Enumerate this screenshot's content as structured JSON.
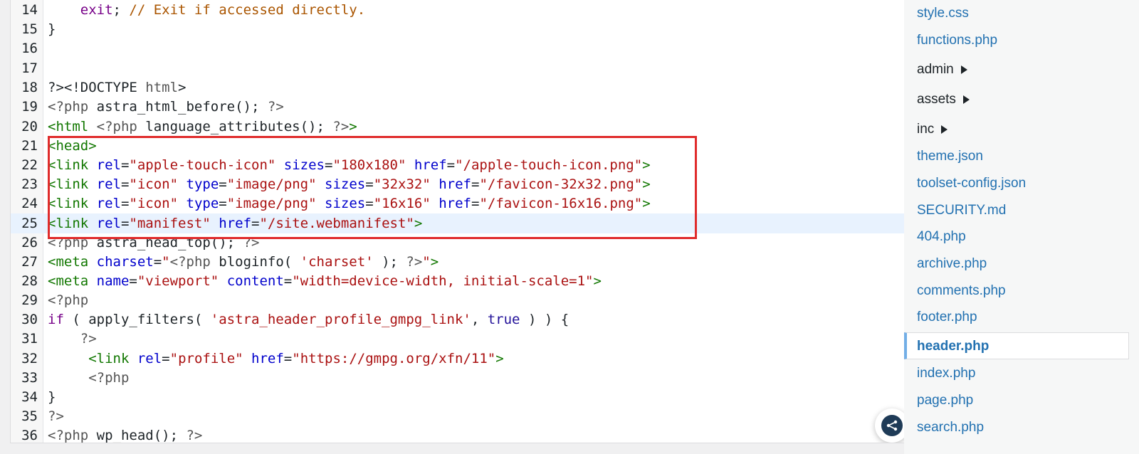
{
  "editor": {
    "lines": [
      {
        "num": "14",
        "indent": "    ",
        "tokens": [
          {
            "t": "exit",
            "c": "kw"
          },
          {
            "t": "; ",
            "c": ""
          },
          {
            "t": "// Exit if accessed directly.",
            "c": "cm"
          }
        ]
      },
      {
        "num": "15",
        "tokens": [
          {
            "t": "}",
            "c": ""
          }
        ]
      },
      {
        "num": "16",
        "tokens": []
      },
      {
        "num": "17",
        "tokens": []
      },
      {
        "num": "18",
        "tokens": [
          {
            "t": "?><!DOCTYPE ",
            "c": ""
          },
          {
            "t": "html",
            "c": "meta"
          },
          {
            "t": ">",
            "c": ""
          }
        ]
      },
      {
        "num": "19",
        "tokens": [
          {
            "t": "<?php",
            "c": "meta"
          },
          {
            "t": " astra_html_before(); ",
            "c": ""
          },
          {
            "t": "?>",
            "c": "meta"
          }
        ]
      },
      {
        "num": "20",
        "tokens": [
          {
            "t": "<html ",
            "c": "tag"
          },
          {
            "t": "<?php",
            "c": "meta"
          },
          {
            "t": " language_attributes(); ",
            "c": ""
          },
          {
            "t": "?>",
            "c": "meta"
          },
          {
            "t": ">",
            "c": "tag"
          }
        ]
      },
      {
        "num": "21",
        "tokens": [
          {
            "t": "<head>",
            "c": "tag"
          }
        ]
      },
      {
        "num": "22",
        "tokens": [
          {
            "t": "<link ",
            "c": "tag"
          },
          {
            "t": "rel",
            "c": "attr"
          },
          {
            "t": "=",
            "c": ""
          },
          {
            "t": "\"apple-touch-icon\"",
            "c": "str"
          },
          {
            "t": " ",
            "c": ""
          },
          {
            "t": "sizes",
            "c": "attr"
          },
          {
            "t": "=",
            "c": ""
          },
          {
            "t": "\"180x180\"",
            "c": "str"
          },
          {
            "t": " ",
            "c": ""
          },
          {
            "t": "href",
            "c": "attr"
          },
          {
            "t": "=",
            "c": ""
          },
          {
            "t": "\"/apple-touch-icon.png\"",
            "c": "str"
          },
          {
            "t": ">",
            "c": "tag"
          }
        ]
      },
      {
        "num": "23",
        "tokens": [
          {
            "t": "<link ",
            "c": "tag"
          },
          {
            "t": "rel",
            "c": "attr"
          },
          {
            "t": "=",
            "c": ""
          },
          {
            "t": "\"icon\"",
            "c": "str"
          },
          {
            "t": " ",
            "c": ""
          },
          {
            "t": "type",
            "c": "attr"
          },
          {
            "t": "=",
            "c": ""
          },
          {
            "t": "\"image/png\"",
            "c": "str"
          },
          {
            "t": " ",
            "c": ""
          },
          {
            "t": "sizes",
            "c": "attr"
          },
          {
            "t": "=",
            "c": ""
          },
          {
            "t": "\"32x32\"",
            "c": "str"
          },
          {
            "t": " ",
            "c": ""
          },
          {
            "t": "href",
            "c": "attr"
          },
          {
            "t": "=",
            "c": ""
          },
          {
            "t": "\"/favicon-32x32.png\"",
            "c": "str"
          },
          {
            "t": ">",
            "c": "tag"
          }
        ]
      },
      {
        "num": "24",
        "tokens": [
          {
            "t": "<link ",
            "c": "tag"
          },
          {
            "t": "rel",
            "c": "attr"
          },
          {
            "t": "=",
            "c": ""
          },
          {
            "t": "\"icon\"",
            "c": "str"
          },
          {
            "t": " ",
            "c": ""
          },
          {
            "t": "type",
            "c": "attr"
          },
          {
            "t": "=",
            "c": ""
          },
          {
            "t": "\"image/png\"",
            "c": "str"
          },
          {
            "t": " ",
            "c": ""
          },
          {
            "t": "sizes",
            "c": "attr"
          },
          {
            "t": "=",
            "c": ""
          },
          {
            "t": "\"16x16\"",
            "c": "str"
          },
          {
            "t": " ",
            "c": ""
          },
          {
            "t": "href",
            "c": "attr"
          },
          {
            "t": "=",
            "c": ""
          },
          {
            "t": "\"/favicon-16x16.png\"",
            "c": "str"
          },
          {
            "t": ">",
            "c": "tag"
          }
        ]
      },
      {
        "num": "25",
        "active": true,
        "tokens": [
          {
            "t": "<link ",
            "c": "tag"
          },
          {
            "t": "rel",
            "c": "attr"
          },
          {
            "t": "=",
            "c": ""
          },
          {
            "t": "\"manifest\"",
            "c": "str"
          },
          {
            "t": " ",
            "c": ""
          },
          {
            "t": "href",
            "c": "attr"
          },
          {
            "t": "=",
            "c": ""
          },
          {
            "t": "\"/site.webmanifest\"",
            "c": "str"
          },
          {
            "t": ">",
            "c": "tag"
          }
        ]
      },
      {
        "num": "26",
        "tokens": [
          {
            "t": "<?php",
            "c": "meta"
          },
          {
            "t": " astra_head_top(); ",
            "c": ""
          },
          {
            "t": "?>",
            "c": "meta"
          }
        ]
      },
      {
        "num": "27",
        "tokens": [
          {
            "t": "<meta ",
            "c": "tag"
          },
          {
            "t": "charset",
            "c": "attr"
          },
          {
            "t": "=",
            "c": ""
          },
          {
            "t": "\"",
            "c": "str"
          },
          {
            "t": "<?php",
            "c": "meta"
          },
          {
            "t": " bloginfo( ",
            "c": ""
          },
          {
            "t": "'charset'",
            "c": "str"
          },
          {
            "t": " ); ",
            "c": ""
          },
          {
            "t": "?>",
            "c": "meta"
          },
          {
            "t": "\"",
            "c": "str"
          },
          {
            "t": ">",
            "c": "tag"
          }
        ]
      },
      {
        "num": "28",
        "tokens": [
          {
            "t": "<meta ",
            "c": "tag"
          },
          {
            "t": "name",
            "c": "attr"
          },
          {
            "t": "=",
            "c": ""
          },
          {
            "t": "\"viewport\"",
            "c": "str"
          },
          {
            "t": " ",
            "c": ""
          },
          {
            "t": "content",
            "c": "attr"
          },
          {
            "t": "=",
            "c": ""
          },
          {
            "t": "\"width=device-width, initial-scale=1\"",
            "c": "str"
          },
          {
            "t": ">",
            "c": "tag"
          }
        ]
      },
      {
        "num": "29",
        "tokens": [
          {
            "t": "<?php",
            "c": "meta"
          }
        ]
      },
      {
        "num": "30",
        "tokens": [
          {
            "t": "if",
            "c": "kw"
          },
          {
            "t": " ( apply_filters( ",
            "c": ""
          },
          {
            "t": "'astra_header_profile_gmpg_link'",
            "c": "str"
          },
          {
            "t": ", ",
            "c": ""
          },
          {
            "t": "true",
            "c": "atom"
          },
          {
            "t": " ) ) {",
            "c": ""
          }
        ]
      },
      {
        "num": "31",
        "indent": "    ",
        "tokens": [
          {
            "t": "?>",
            "c": "meta"
          }
        ]
      },
      {
        "num": "32",
        "indent": "     ",
        "tokens": [
          {
            "t": "<link ",
            "c": "tag"
          },
          {
            "t": "rel",
            "c": "attr"
          },
          {
            "t": "=",
            "c": ""
          },
          {
            "t": "\"profile\"",
            "c": "str"
          },
          {
            "t": " ",
            "c": ""
          },
          {
            "t": "href",
            "c": "attr"
          },
          {
            "t": "=",
            "c": ""
          },
          {
            "t": "\"https://gmpg.org/xfn/11\"",
            "c": "str"
          },
          {
            "t": ">",
            "c": "tag"
          }
        ]
      },
      {
        "num": "33",
        "indent": "     ",
        "tokens": [
          {
            "t": "<?php",
            "c": "meta"
          }
        ]
      },
      {
        "num": "34",
        "tokens": [
          {
            "t": "}",
            "c": ""
          }
        ]
      },
      {
        "num": "35",
        "tokens": [
          {
            "t": "?>",
            "c": "meta"
          }
        ]
      },
      {
        "num": "36",
        "tokens": [
          {
            "t": "<?php",
            "c": "meta"
          },
          {
            "t": " wp_head(); ",
            "c": ""
          },
          {
            "t": "?>",
            "c": "meta"
          }
        ]
      }
    ]
  },
  "fab": {
    "icon": "share-icon"
  },
  "colors": {
    "highlight_border": "#e02b2b",
    "active_line": "#e8f2fe",
    "link": "#2271b1"
  },
  "sidebar": {
    "files": [
      {
        "label": "style.css",
        "folder": false
      },
      {
        "label": "functions.php",
        "folder": false
      },
      {
        "label": "admin",
        "folder": true
      },
      {
        "label": "assets",
        "folder": true
      },
      {
        "label": "inc",
        "folder": true
      },
      {
        "label": "theme.json",
        "folder": false
      },
      {
        "label": "toolset-config.json",
        "folder": false
      },
      {
        "label": "SECURITY.md",
        "folder": false
      },
      {
        "label": "404.php",
        "folder": false
      },
      {
        "label": "archive.php",
        "folder": false
      },
      {
        "label": "comments.php",
        "folder": false
      },
      {
        "label": "footer.php",
        "folder": false
      },
      {
        "label": "header.php",
        "folder": false,
        "active": true
      },
      {
        "label": "index.php",
        "folder": false
      },
      {
        "label": "page.php",
        "folder": false
      },
      {
        "label": "search.php",
        "folder": false
      }
    ]
  }
}
